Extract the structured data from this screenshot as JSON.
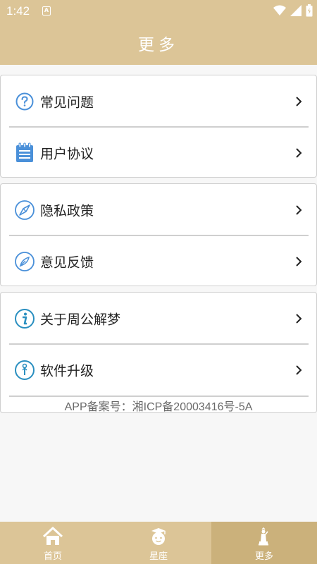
{
  "status_bar": {
    "time": "1:42",
    "notification_badge": "A"
  },
  "header": {
    "title": "更多"
  },
  "menu": {
    "group1": [
      {
        "label": "常见问题",
        "icon": "question-circle-icon"
      },
      {
        "label": "用户协议",
        "icon": "notepad-icon"
      }
    ],
    "group2": [
      {
        "label": "隐私政策",
        "icon": "compass-icon"
      },
      {
        "label": "意见反馈",
        "icon": "feather-icon"
      }
    ],
    "group3": [
      {
        "label": "关于周公解梦",
        "icon": "info-circle-icon"
      },
      {
        "label": "软件升级",
        "icon": "upgrade-circle-icon"
      }
    ]
  },
  "icp_text": "APP备案号：湘ICP备20003416号-5A",
  "tabs": [
    {
      "label": "首页",
      "icon": "home-icon",
      "active": false
    },
    {
      "label": "星座",
      "icon": "zodiac-avatar-icon",
      "active": false
    },
    {
      "label": "更多",
      "icon": "more-statue-icon",
      "active": true
    }
  ],
  "colors": {
    "header_bg": "#dcc597",
    "tab_active_bg": "#cbb17b",
    "icon_blue": "#4a90d9"
  }
}
